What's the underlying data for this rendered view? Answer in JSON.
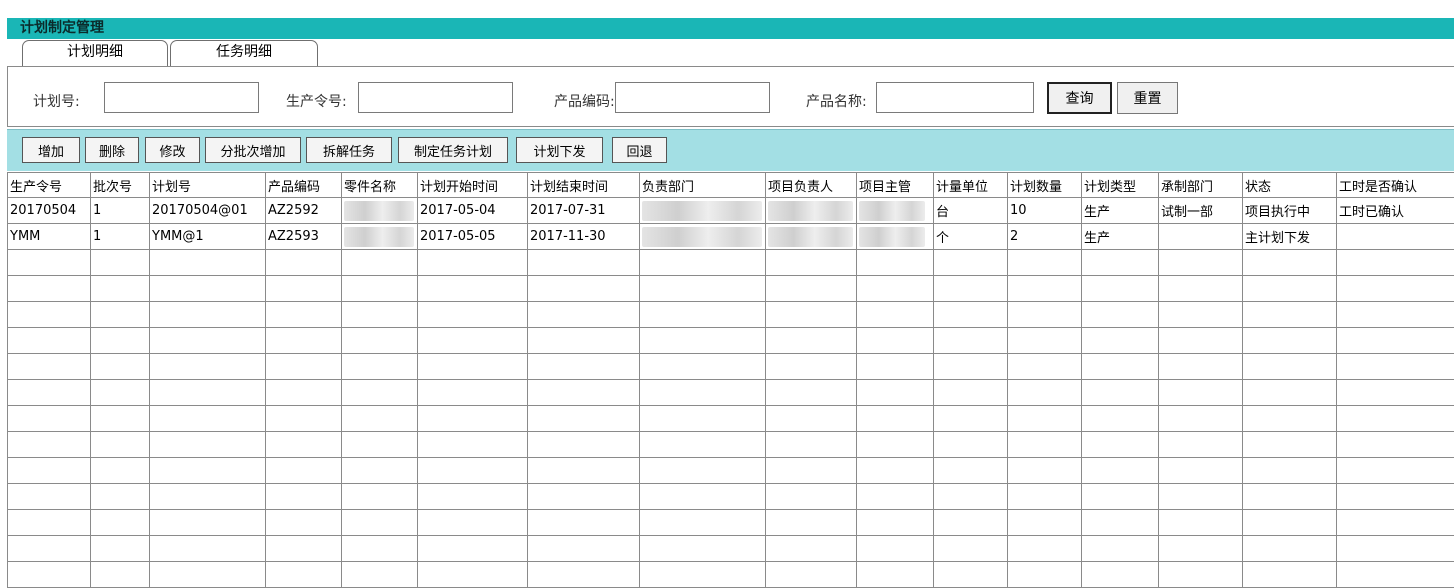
{
  "window": {
    "title": "计划制定管理"
  },
  "tabs": [
    {
      "label": "计划明细"
    },
    {
      "label": "任务明细"
    }
  ],
  "search": {
    "plan_no_label": "计划号:",
    "prod_order_label": "生产令号:",
    "product_code_label": "产品编码:",
    "product_name_label": "产品名称:",
    "plan_no_value": "",
    "prod_order_value": "",
    "product_code_value": "",
    "product_name_value": "",
    "query_button": "查询",
    "reset_button": "重置"
  },
  "toolbar": {
    "add": "增加",
    "delete": "删除",
    "edit": "修改",
    "batch_add": "分批次增加",
    "split_task": "拆解任务",
    "make_task_plan": "制定任务计划",
    "issue_plan": "计划下发",
    "rollback": "回退"
  },
  "table": {
    "columns": [
      "生产令号",
      "批次号",
      "计划号",
      "产品编码",
      "零件名称",
      "计划开始时间",
      "计划结束时间",
      "负责部门",
      "项目负责人",
      "项目主管",
      "计量单位",
      "计划数量",
      "计划类型",
      "承制部门",
      "状态",
      "工时是否确认"
    ],
    "rows": [
      [
        "20170504",
        "1",
        "20170504@01",
        "AZ2592",
        "",
        "2017-05-04",
        "2017-07-31",
        "",
        "",
        "",
        "台",
        "10",
        "生产",
        "试制一部",
        "项目执行中",
        "工时已确认"
      ],
      [
        "YMM",
        "1",
        "YMM@1",
        "AZ2593",
        "",
        "2017-05-05",
        "2017-11-30",
        "",
        "",
        "",
        "个",
        "2",
        "生产",
        "",
        "主计划下发",
        ""
      ]
    ]
  },
  "colors": {
    "title_bar": "#1ab6b6",
    "toolbar_bg": "#a3dfe4"
  }
}
